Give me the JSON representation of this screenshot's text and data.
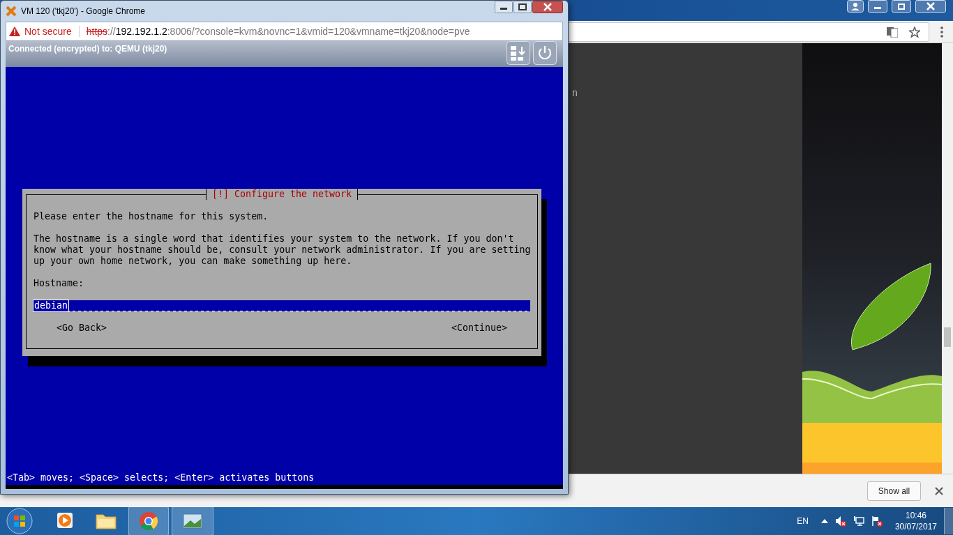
{
  "background_browser": {
    "page_text": "n",
    "download_bar": {
      "button": "Show all"
    }
  },
  "popup_window": {
    "title": "VM 120 ('tkj20') - Google Chrome",
    "security_label": "Not secure",
    "url_parts": [
      {
        "kind": "scheme",
        "text": "https"
      },
      {
        "kind": "plain",
        "text": "://"
      },
      {
        "kind": "host",
        "text": "192.192.1.2"
      },
      {
        "kind": "plain",
        "text": ":8006/?console=kvm&novnc=1&vmid=120&vmname=tkj20&node=pve"
      }
    ],
    "vnc_status": "Connected (encrypted) to: QEMU (tkj20)",
    "installer": {
      "title": "[!] Configure the network",
      "paragraphs": [
        "Please enter the hostname for this system.",
        "The hostname is a single word that identifies your system to the network. If you don't\nknow what your hostname should be, consult your network administrator. If you are setting\nup your own home network, you can make something up here."
      ],
      "field_label": "Hostname:",
      "hostname_value": "debian",
      "buttons": [
        {
          "label": "<Go Back>",
          "selected": false
        },
        {
          "label": "<Continue>",
          "selected": false
        }
      ],
      "help_line": "<Tab> moves; <Space> selects; <Enter> activates buttons"
    }
  },
  "taskbar": {
    "language": "EN",
    "time": "10:46",
    "date": "30/07/2017"
  }
}
